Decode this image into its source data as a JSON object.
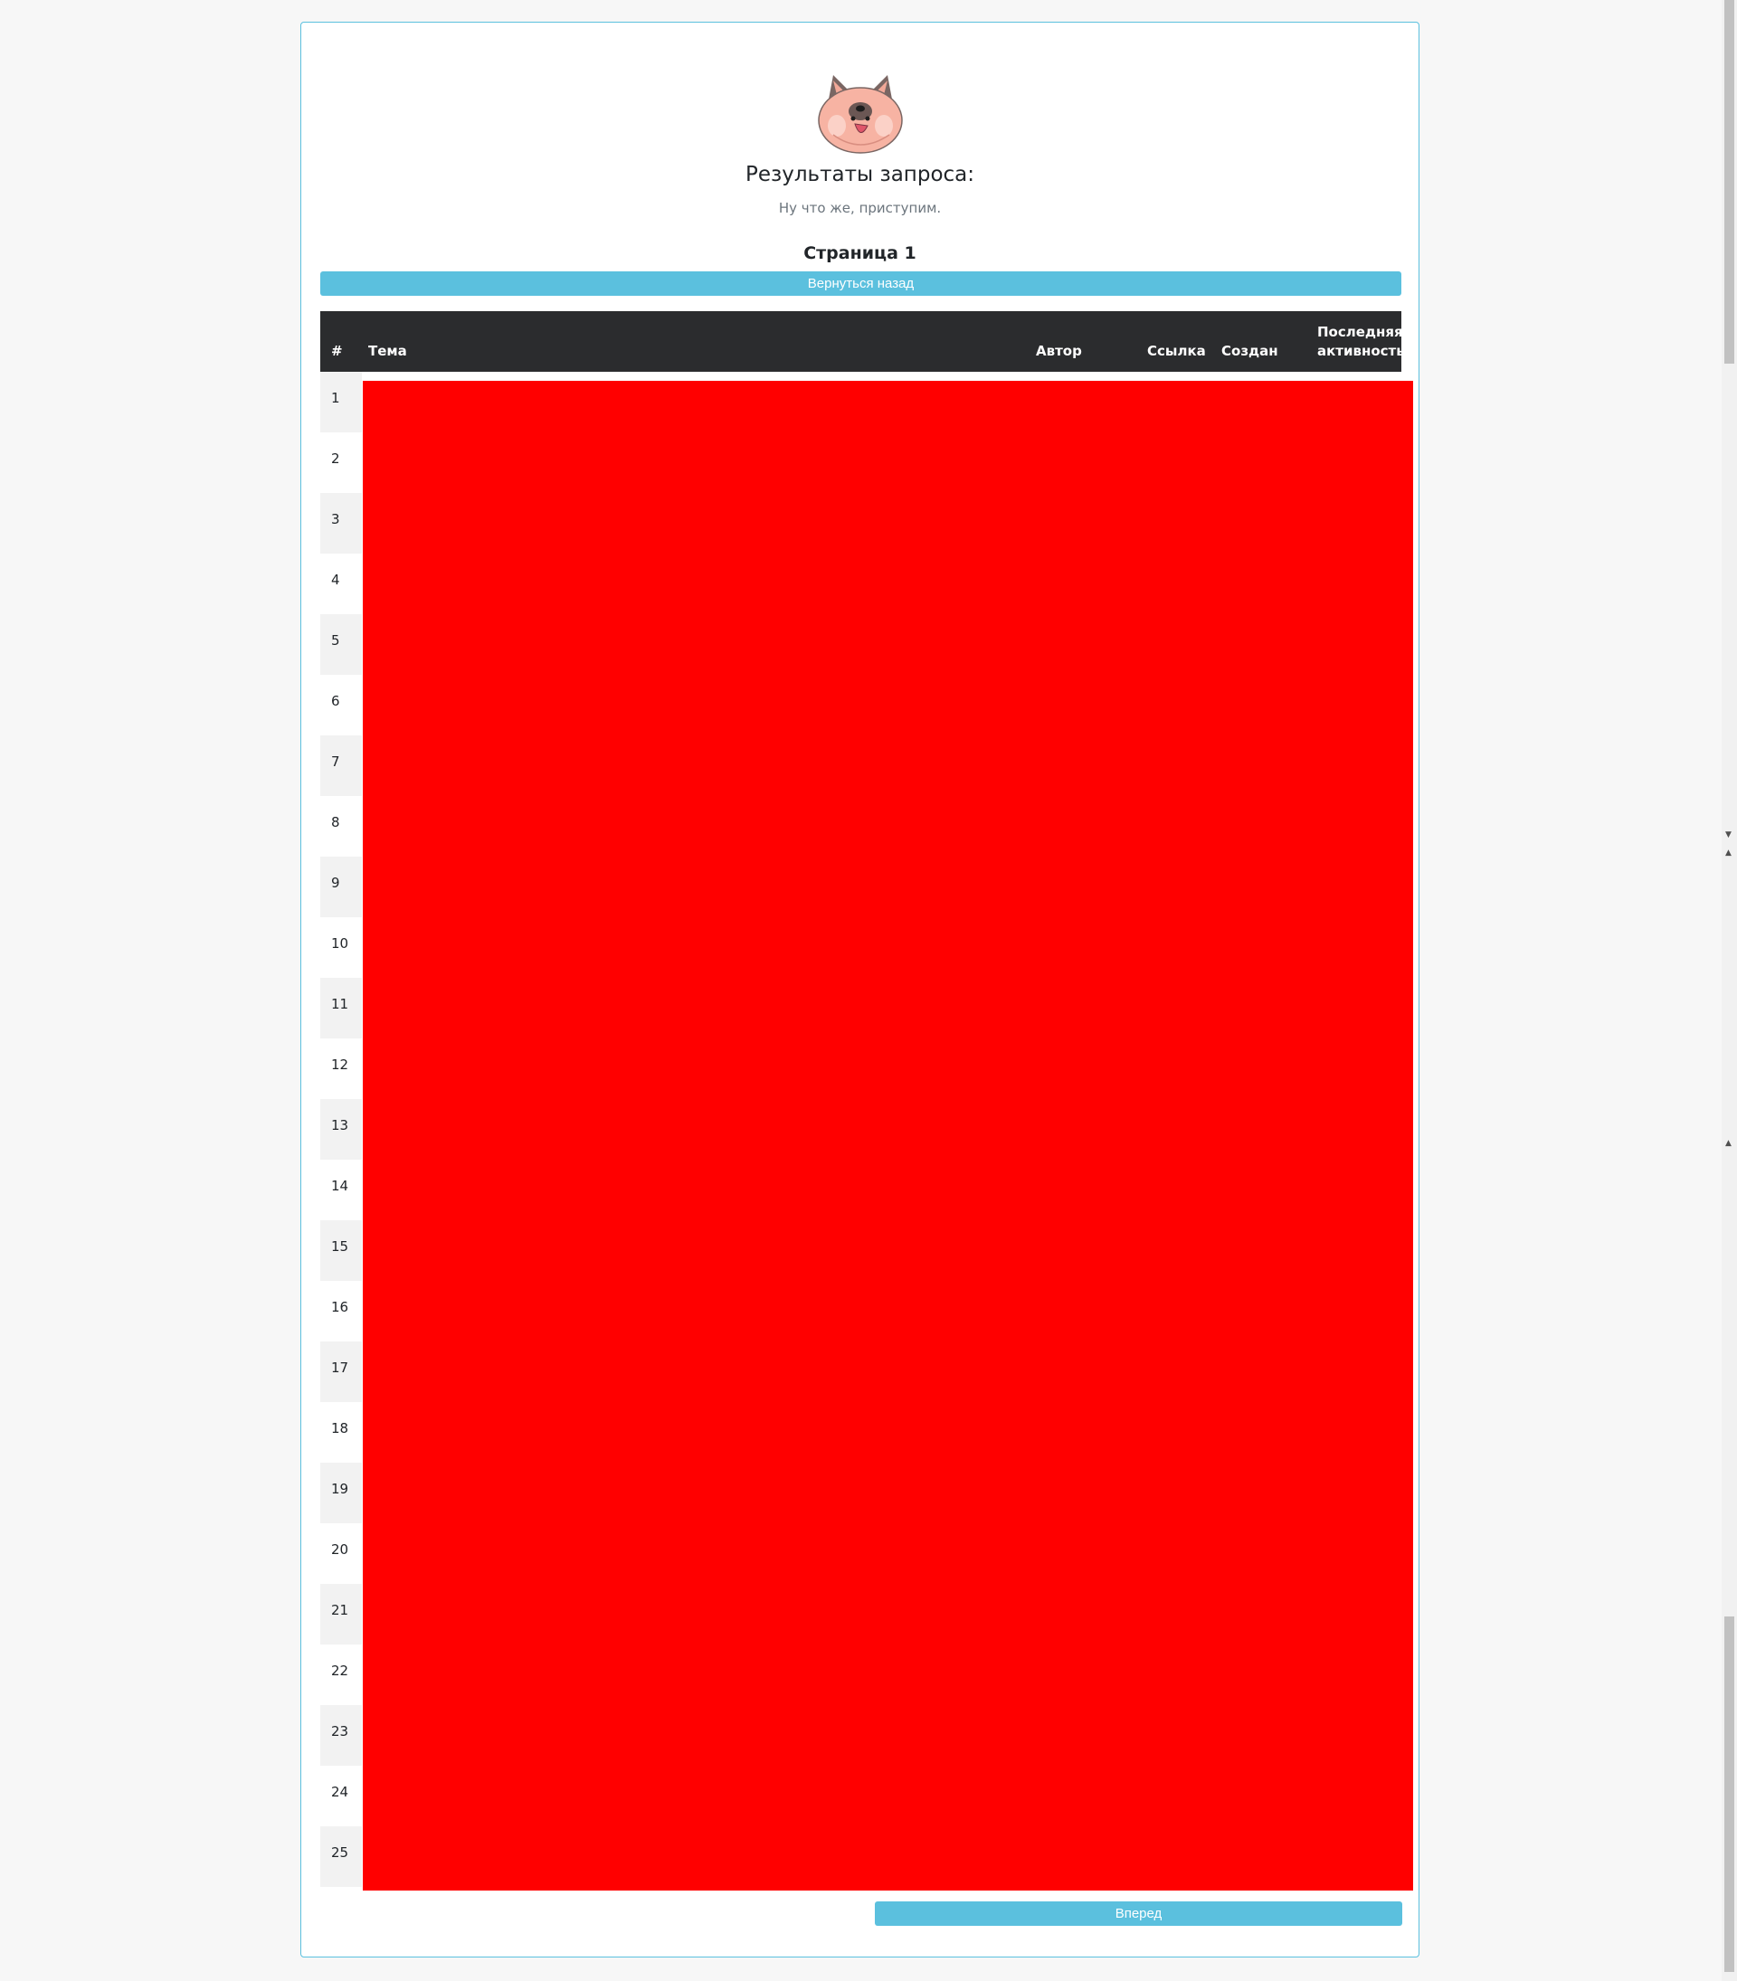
{
  "header": {
    "title": "Результаты запроса:",
    "subtitle": "Ну что же, приступим.",
    "page_label": "Страница 1"
  },
  "buttons": {
    "back_label": "Вернуться назад",
    "next_label": "Вперед"
  },
  "table": {
    "columns": [
      "#",
      "Тема",
      "Автор",
      "Ссылка",
      "Создан",
      "Последняя активность"
    ],
    "row_numbers": [
      "1",
      "2",
      "3",
      "4",
      "5",
      "6",
      "7",
      "8",
      "9",
      "10",
      "11",
      "12",
      "13",
      "14",
      "15",
      "16",
      "17",
      "18",
      "19",
      "20",
      "21",
      "22",
      "23",
      "24",
      "25"
    ]
  },
  "colors": {
    "accent": "#5bc0de",
    "table_header_bg": "#2b2c2e",
    "redaction": "#ff0000",
    "page_bg": "#f7f7f7"
  },
  "icons": [
    "cat-logo-icon",
    "scroll-up-arrow-icon",
    "scroll-down-arrow-icon"
  ]
}
